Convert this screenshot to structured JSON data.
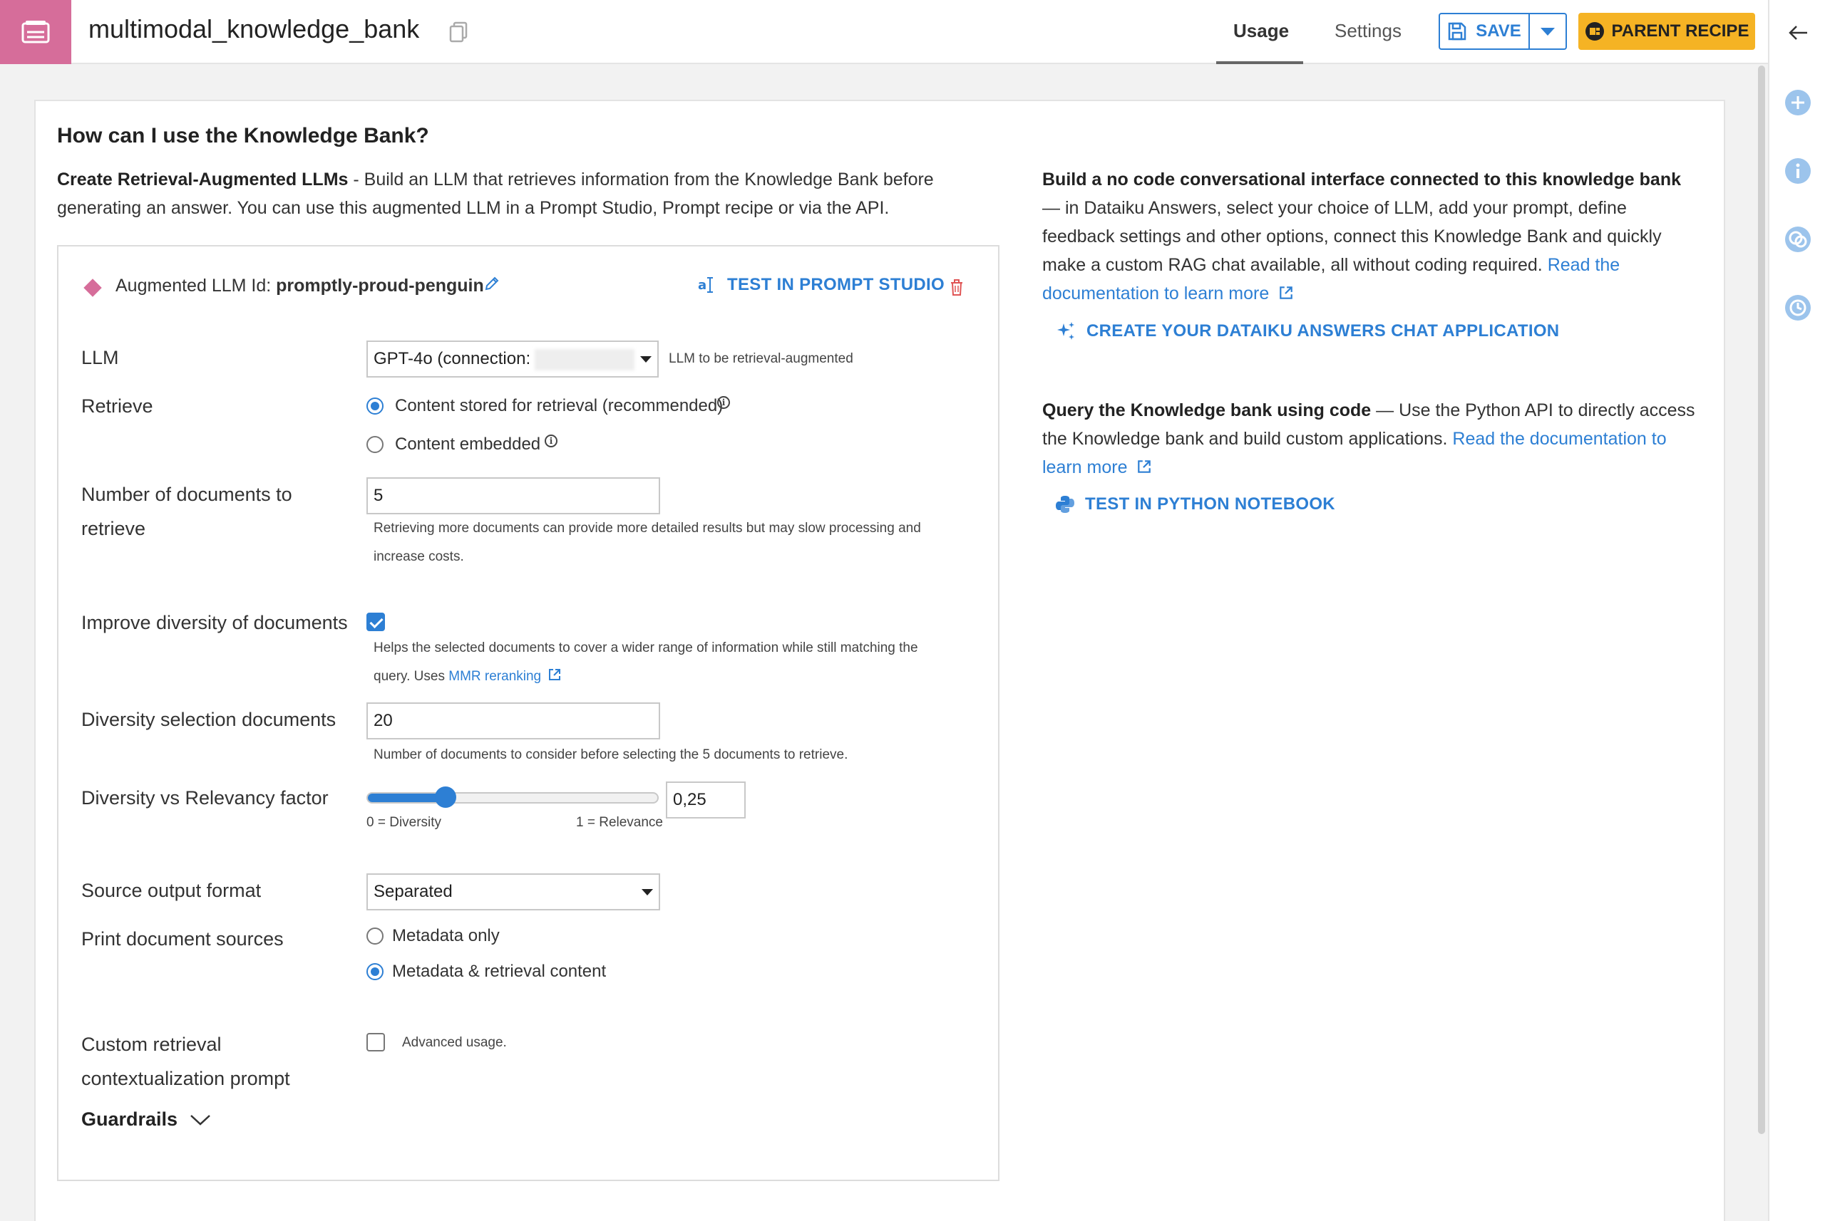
{
  "header": {
    "title": "multimodal_knowledge_bank",
    "tabs": [
      {
        "label": "Usage",
        "active": true
      },
      {
        "label": "Settings",
        "active": false
      }
    ],
    "save_label": "SAVE",
    "parent_recipe_label": "PARENT RECIPE"
  },
  "colors": {
    "app_icon": "#d66d9a",
    "accent": "#2d7fd4",
    "parent_recipe": "#f5b324"
  },
  "main": {
    "heading": "How can I use the Knowledge Bank?",
    "rag_title": "Create Retrieval-Augmented LLMs",
    "rag_text": " - Build an LLM that retrieves information from the Knowledge Bank before generating an answer. You can use this augmented LLM in a Prompt Studio, Prompt recipe or via the API.",
    "augmented": {
      "id_label": "Augmented LLM Id: ",
      "id_value": "promptly-proud-penguin",
      "test_prompt_studio": "TEST IN PROMPT STUDIO"
    },
    "form": {
      "llm_label": "LLM",
      "llm_value": "GPT-4o (connection:",
      "llm_help": "LLM to be retrieval-augmented",
      "retrieve_label": "Retrieve",
      "retrieve_options": [
        {
          "label": "Content stored for retrieval (recommended)",
          "selected": true
        },
        {
          "label": "Content embedded",
          "selected": false
        }
      ],
      "num_docs_label_1": "Number of documents to",
      "num_docs_label_2": "retrieve",
      "num_docs_value": "5",
      "num_docs_help_1": "Retrieving more documents can provide more detailed results but may slow processing and",
      "num_docs_help_2": "increase costs.",
      "diversity_label": "Improve diversity of documents",
      "diversity_checked": true,
      "diversity_help_1": "Helps the selected documents to cover a wider range of information while still matching the",
      "diversity_help_2": "query. Uses ",
      "mmr_link": "MMR reranking",
      "div_sel_label": "Diversity selection documents",
      "div_sel_value": "20",
      "div_sel_help": "Number of documents to consider before selecting the 5 documents to retrieve.",
      "factor_label": "Diversity vs Relevancy factor",
      "factor_value": "0,25",
      "factor_fraction": 0.25,
      "factor_min_caption": "0 = Diversity",
      "factor_max_caption": "1 = Relevance",
      "source_format_label": "Source output format",
      "source_format_value": "Separated",
      "print_sources_label": "Print document sources",
      "print_sources_options": [
        {
          "label": "Metadata only",
          "selected": false
        },
        {
          "label": "Metadata & retrieval content",
          "selected": true
        }
      ],
      "custom_prompt_label_1": "Custom retrieval",
      "custom_prompt_label_2": "contextualization prompt",
      "custom_prompt_checked": false,
      "custom_prompt_help": "Advanced usage.",
      "guardrails_label": "Guardrails"
    },
    "answers": {
      "title": "Build a no code conversational interface connected to this knowledge bank",
      "text": " — in Dataiku Answers, select your choice of LLM, add your prompt, define feedback settings and other options, connect this Knowledge Bank and quickly make a custom RAG chat available, all without coding required. ",
      "doc_link": "Read the documentation to learn more",
      "action": "CREATE YOUR DATAIKU ANSWERS CHAT APPLICATION"
    },
    "code": {
      "title": "Query the Knowledge bank using code",
      "text": " — Use the Python API to directly access the Knowledge bank and build custom applications. ",
      "doc_link": "Read the documentation to learn more",
      "action": "TEST IN PYTHON NOTEBOOK"
    }
  },
  "rail": {
    "icons": [
      "back-arrow-icon",
      "plus-circle-icon",
      "info-icon",
      "chat-icon",
      "clock-icon"
    ]
  }
}
